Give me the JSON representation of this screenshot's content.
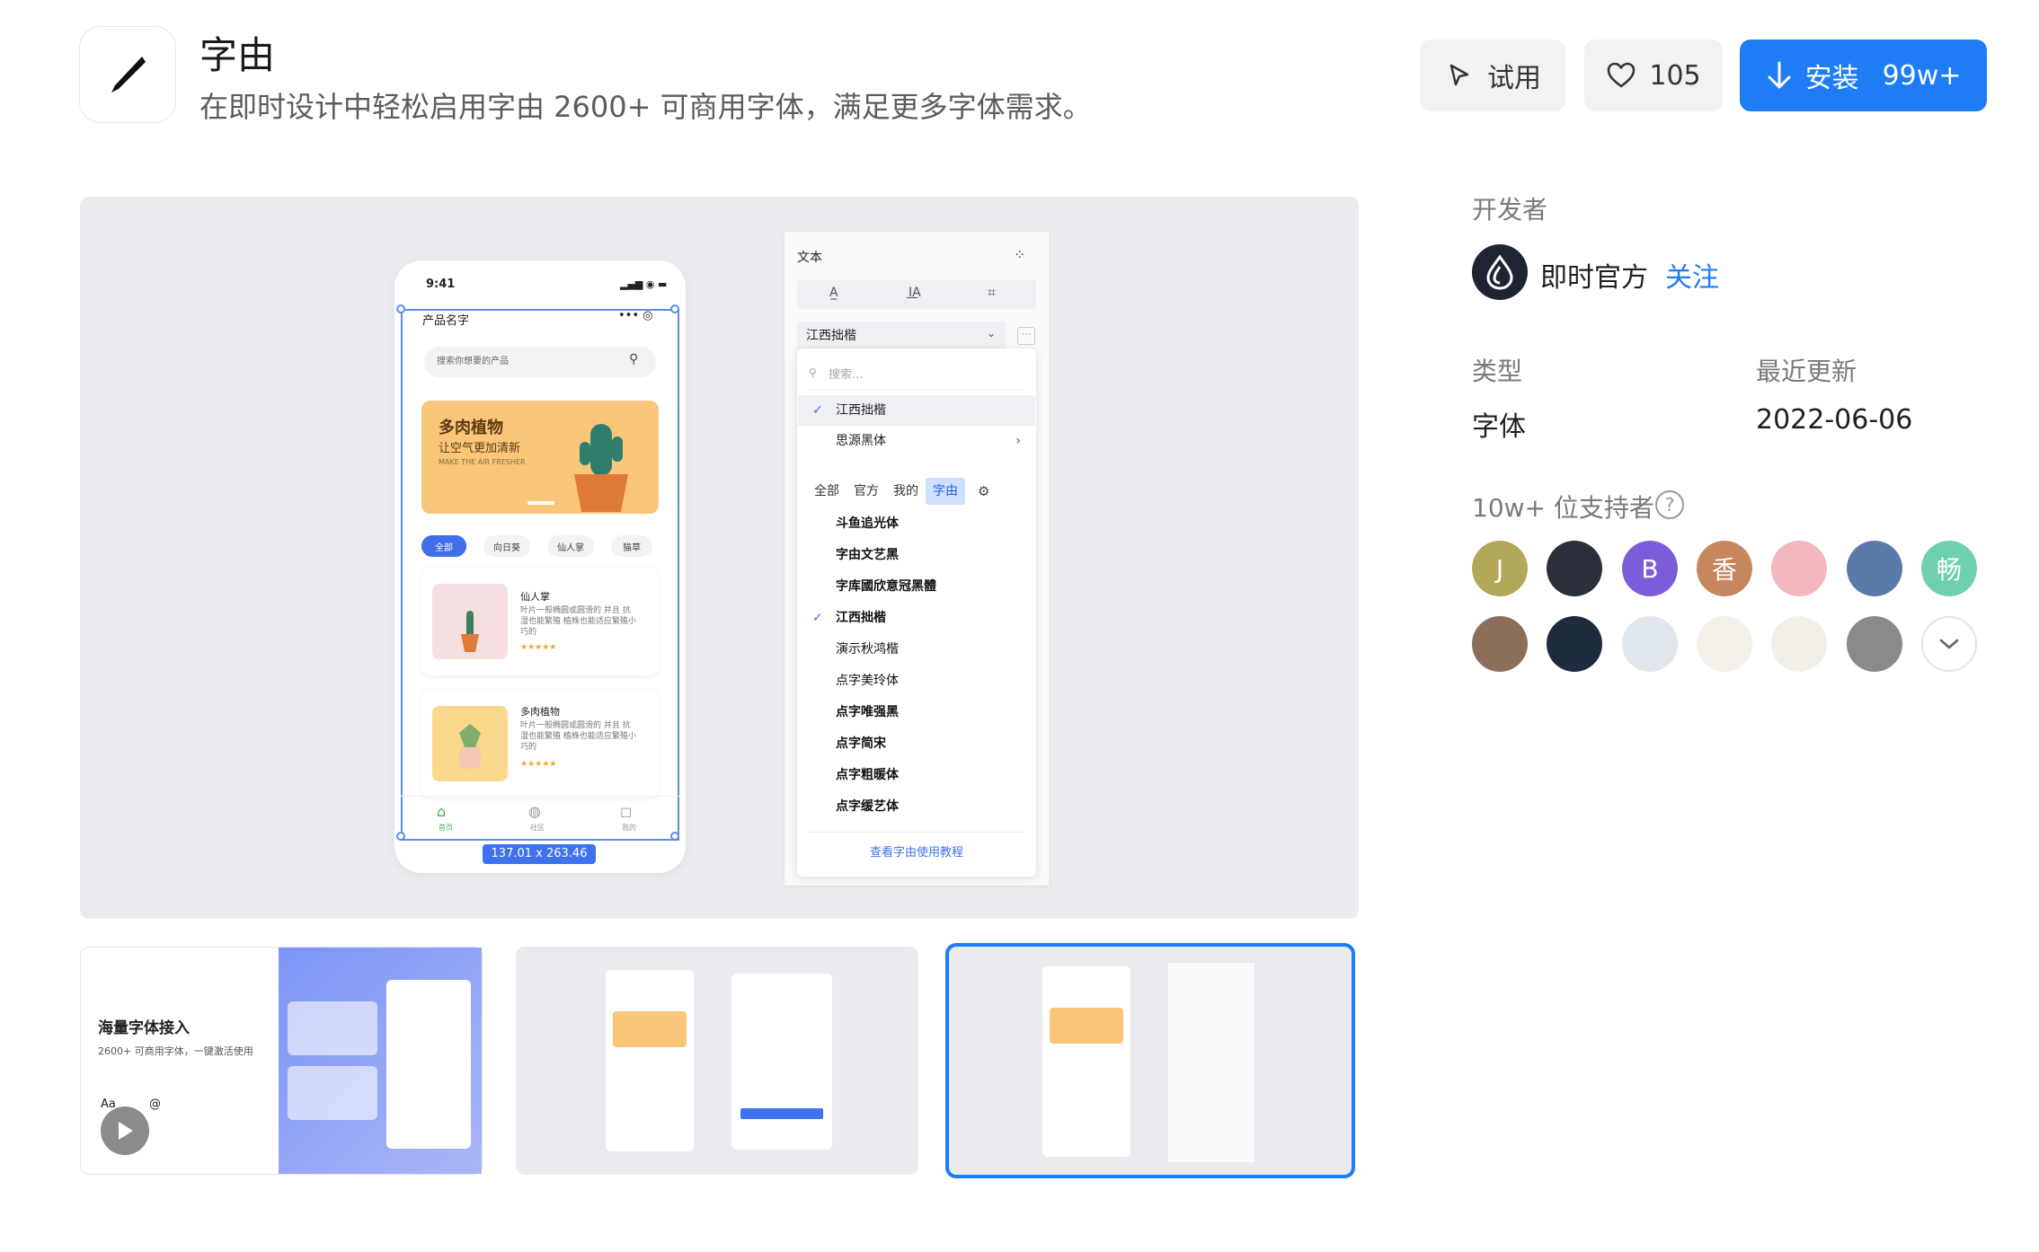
{
  "header": {
    "title": "字由",
    "description": "在即时设计中轻松启用字由 2600+ 可商用字体，满足更多字体需求。",
    "try_label": "试用",
    "like_count": "105",
    "install_label": "安装",
    "install_count": "99w+"
  },
  "preview": {
    "phone": {
      "time": "9:41",
      "product_label": "产品名字",
      "search_placeholder": "搜索你想要的产品",
      "banner_title": "多肉植物",
      "banner_sub": "让空气更加清新",
      "banner_small": "MAKE THE AIR FRESHER",
      "chips": [
        "全部",
        "向日葵",
        "仙人掌",
        "猫草"
      ],
      "cards": [
        {
          "title": "仙人掌",
          "text": "叶片一般椭圆或圆滑的 并且 抗湿也能繁殖 植株也能适应繁殖小巧的",
          "stars": "★★★★★"
        },
        {
          "title": "多肉植物",
          "text": "叶片一般椭圆或圆滑的 并且 抗湿也能繁殖 植株也能适应繁殖小巧的",
          "stars": "★★★★★"
        }
      ],
      "nav": [
        "首页",
        "社区",
        "我的"
      ],
      "dimension": "137.01 x 263.46"
    },
    "panel": {
      "header": "文本",
      "selected_font": "江西拙楷",
      "search_placeholder": "搜索...",
      "recent": [
        "江西拙楷",
        "思源黑体"
      ],
      "tabs": [
        "全部",
        "官方",
        "我的",
        "字由"
      ],
      "fonts": [
        "斗鱼追光体",
        "字由文艺黑",
        "字库國欣意冠黑體",
        "江西拙楷",
        "演示秋鸿楷",
        "点字美玲体",
        "点字唯强黑",
        "点字简宋",
        "点字粗暖体",
        "点字缓艺体"
      ],
      "tutorial_link": "查看字由使用教程"
    }
  },
  "thumbnails": {
    "t1_title": "海量字体接入",
    "t1_sub": "2600+ 可商用字体，一键激活使用",
    "t1_tag1": "Aa",
    "t1_tag2": "@"
  },
  "sidebar": {
    "developer_label": "开发者",
    "developer_name": "即时官方",
    "follow_label": "关注",
    "type_label": "类型",
    "type_value": "字体",
    "updated_label": "最近更新",
    "updated_value": "2022-06-06",
    "supporters_label": "10w+ 位支持者",
    "help_glyph": "?",
    "supporters": [
      {
        "letter": "J",
        "color": "#b3a75a"
      },
      {
        "letter": "",
        "color": "#2a2f3a"
      },
      {
        "letter": "B",
        "color": "#7b5ddb"
      },
      {
        "letter": "香",
        "color": "#c6875f"
      },
      {
        "letter": "",
        "color": "#f3b7bd"
      },
      {
        "letter": "",
        "color": "#5a7ba8"
      },
      {
        "letter": "畅",
        "color": "#6fd0ad"
      },
      {
        "letter": "",
        "color": "#8b6f5a"
      },
      {
        "letter": "",
        "color": "#1e2a3d"
      },
      {
        "letter": "",
        "color": "#dfe6ec"
      },
      {
        "letter": "",
        "color": "#f4f0ea"
      },
      {
        "letter": "",
        "color": "#f2efe8"
      },
      {
        "letter": "",
        "color": "#8a8a8a"
      }
    ]
  },
  "colors": {
    "primary": "#1e7cf5",
    "preview_bg": "#e9ebee"
  }
}
